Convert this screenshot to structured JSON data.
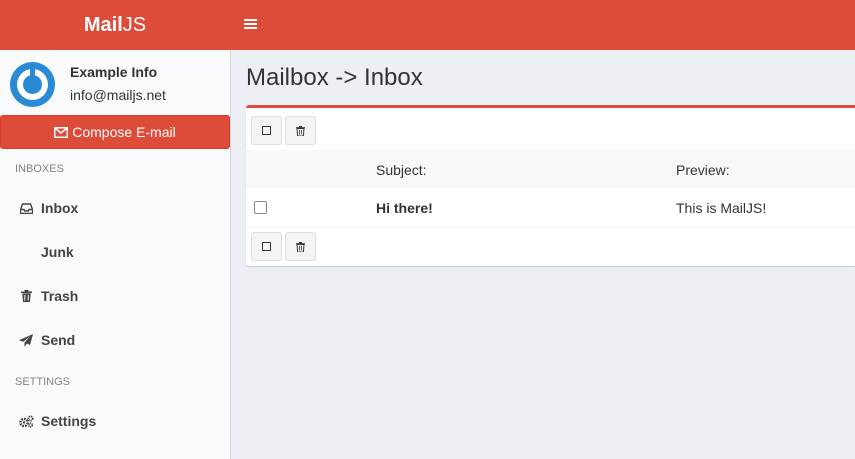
{
  "header": {
    "logo_bold": "Mail",
    "logo_rest": "JS"
  },
  "user": {
    "name": "Example Info",
    "email": "info@mailjs.net"
  },
  "sidebar": {
    "compose_label": "Compose E-mail",
    "sections": [
      {
        "header": "INBOXES",
        "items": [
          {
            "label": "Inbox",
            "icon": "inbox-icon"
          },
          {
            "label": "Junk",
            "icon": ""
          },
          {
            "label": "Trash",
            "icon": "trash-icon"
          },
          {
            "label": "Send",
            "icon": "paper-plane-icon"
          }
        ]
      },
      {
        "header": "SETTINGS",
        "items": [
          {
            "label": "Settings",
            "icon": "cogs-icon"
          }
        ]
      }
    ]
  },
  "main": {
    "title": "Mailbox -> Inbox",
    "table": {
      "columns": [
        "Subject:",
        "Preview:"
      ],
      "rows": [
        {
          "subject": "Hi there!",
          "preview": "This is MailJS!"
        }
      ]
    }
  },
  "colors": {
    "brand": "#dd4b39",
    "avatar": "#2a8bd4",
    "background": "#ecf0f5",
    "sidebar": "#f9fafc"
  }
}
